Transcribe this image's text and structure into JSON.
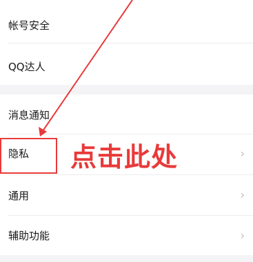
{
  "settings": {
    "items": [
      {
        "label": "帐号安全",
        "chevron": ""
      },
      {
        "label": "QQ达人",
        "chevron": ""
      },
      {
        "label": "消息通知",
        "chevron": ""
      },
      {
        "label": "隐私",
        "chevron": "›"
      },
      {
        "label": "通用",
        "chevron": "›"
      },
      {
        "label": "辅助功能",
        "chevron": "›"
      }
    ]
  },
  "annotation": {
    "text": "点击此处",
    "color": "#e83a3a"
  },
  "colors": {
    "background": "#ffffff",
    "section_gap": "#f4f4f6",
    "divider": "#ececec",
    "chevron": "#b8b8b8",
    "text": "#1a1a1a"
  }
}
